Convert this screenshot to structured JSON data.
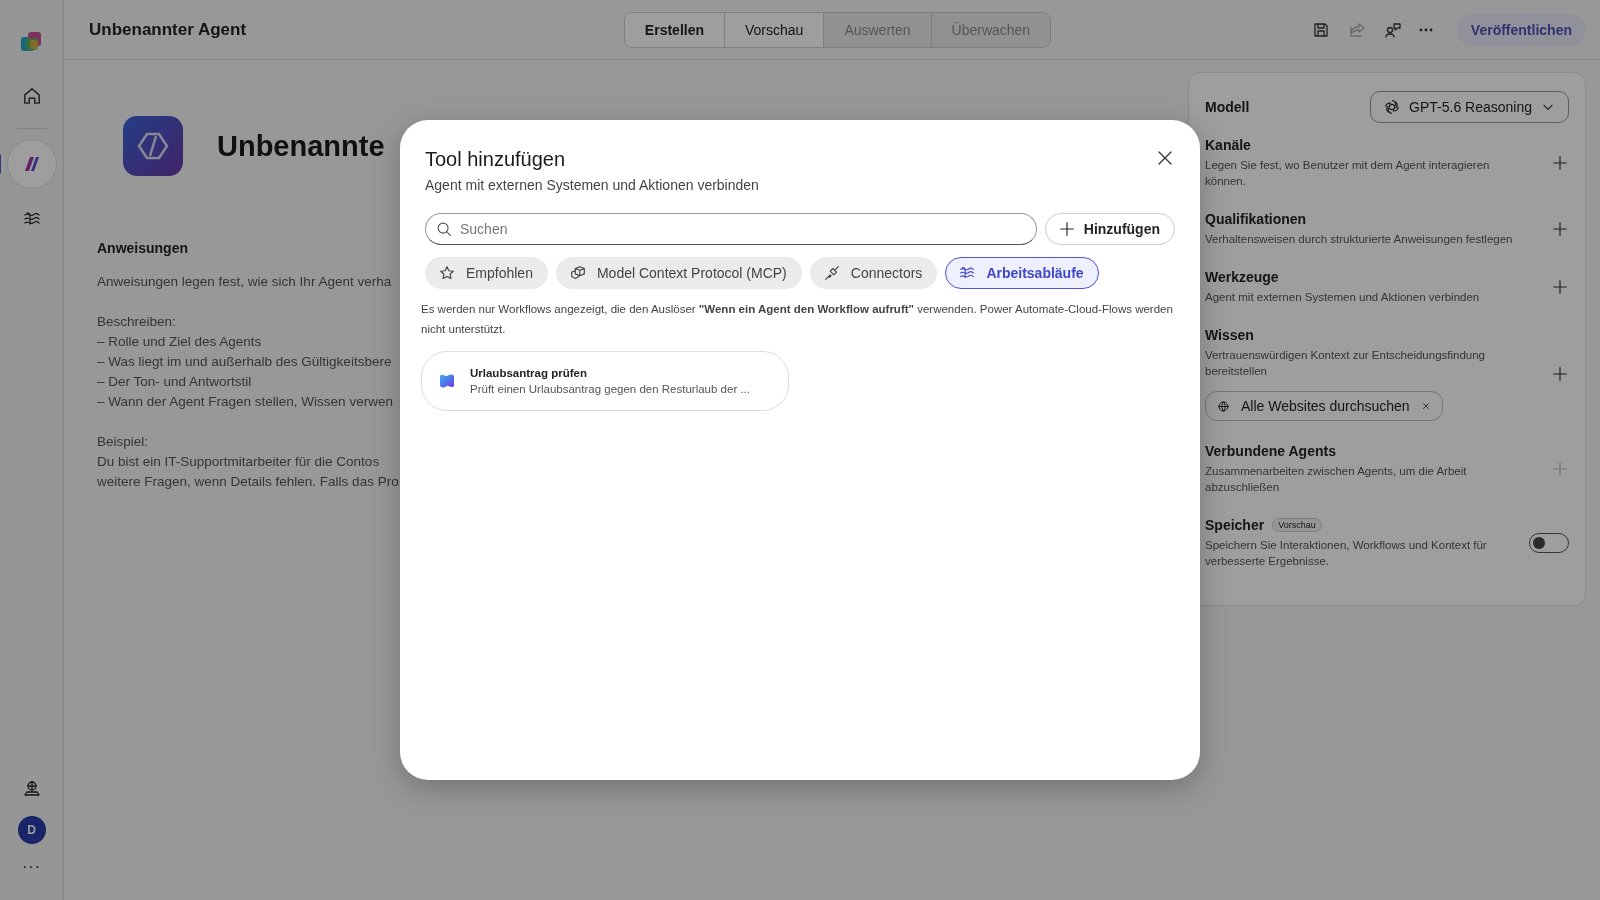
{
  "sidebar": {
    "items": [
      {
        "kind": "logo",
        "selected": false
      },
      {
        "kind": "home",
        "selected": false
      },
      {
        "kind": "agent",
        "selected": true
      },
      {
        "kind": "workflows",
        "selected": false
      }
    ],
    "bottom": {
      "avatar": "D",
      "more": "···"
    }
  },
  "header": {
    "title": "Unbenannter Agent",
    "tabs": [
      {
        "label": "Erstellen",
        "selected": true,
        "disabled": false
      },
      {
        "label": "Vorschau",
        "selected": false,
        "disabled": false
      },
      {
        "label": "Auswerten",
        "selected": false,
        "disabled": true
      },
      {
        "label": "Überwachen",
        "selected": false,
        "disabled": true
      }
    ],
    "actions": [
      {
        "kind": "save",
        "disabled": false
      },
      {
        "kind": "share",
        "disabled": true
      },
      {
        "kind": "people",
        "disabled": false
      },
      {
        "kind": "more",
        "disabled": false
      }
    ],
    "publish": "Veröffentlichen"
  },
  "main": {
    "agent_name": "Unbenannte",
    "heading": "Anweisungen",
    "paragraphs": [
      [
        "Anweisungen legen fest, wie sich Ihr Agent verha"
      ],
      [
        "Beschreiben:",
        "– Rolle und Ziel des Agents",
        "– Was liegt im und außerhalb des Gültigkeitsbere",
        "– Der Ton- und Antwortstil",
        "– Wann der Agent Fragen stellen, Wissen verwen"
      ],
      [
        "Beispiel:",
        "Du bist ein IT-Supportmitarbeiter für die Contos",
        "weitere Fragen, wenn Details fehlen. Falls das Pro"
      ]
    ]
  },
  "panel": {
    "model_label": "Modell",
    "model": "GPT-5.6 Reasoning",
    "sections": [
      {
        "kind": "add",
        "title": "Kanäle",
        "description": "Legen Sie fest, wo Benutzer mit dem Agent interagieren können.",
        "disabled": false
      },
      {
        "kind": "add",
        "title": "Qualifikationen",
        "description": "Verhaltensweisen durch strukturierte Anweisungen festlegen",
        "disabled": false
      },
      {
        "kind": "add",
        "title": "Werkzeuge",
        "description": "Agent mit externen Systemen und Aktionen verbinden",
        "disabled": false
      },
      {
        "kind": "add",
        "title": "Wissen",
        "description": "Vertrauenswürdigen Kontext zur Entscheidungsfindung bereitstellen",
        "disabled": false,
        "chips": [
          "Alle Websites durchsuchen"
        ]
      },
      {
        "kind": "add",
        "title": "Verbundene Agents",
        "description": "Zusammenarbeiten zwischen Agents, um die Arbeit abzuschließen",
        "disabled": true
      },
      {
        "kind": "toggle",
        "title": "Speicher",
        "badge": "Vorschau",
        "description": "Speichern Sie Interaktionen, Workflows und Kontext für verbesserte Ergebnisse.",
        "on": false
      }
    ]
  },
  "dialog": {
    "title": "Tool hinzufügen",
    "subtitle": "Agent mit externen Systemen und Aktionen verbinden",
    "search": {
      "placeholder": "Suchen"
    },
    "add_button": "Hinzufügen",
    "filters": [
      {
        "kind": "star",
        "label": "Empfohlen",
        "selected": false
      },
      {
        "kind": "cubes",
        "label": "Model Context Protocol (MCP)",
        "selected": false
      },
      {
        "kind": "plug",
        "label": "Connectors",
        "selected": false
      },
      {
        "kind": "workflows",
        "label": "Arbeitsabläufe",
        "selected": true
      }
    ],
    "note": "Es werden nur Workflows angezeigt, die den Auslöser **\"Wenn ein Agent den Workflow aufruft\"** verwenden. Power Automate-Cloud-Flows werden nicht unterstützt.",
    "items": [
      {
        "title": "Urlaubsantrag prüfen",
        "description": "Prüft einen Urlaubsantrag gegen den Resturlaub der ..."
      }
    ]
  }
}
